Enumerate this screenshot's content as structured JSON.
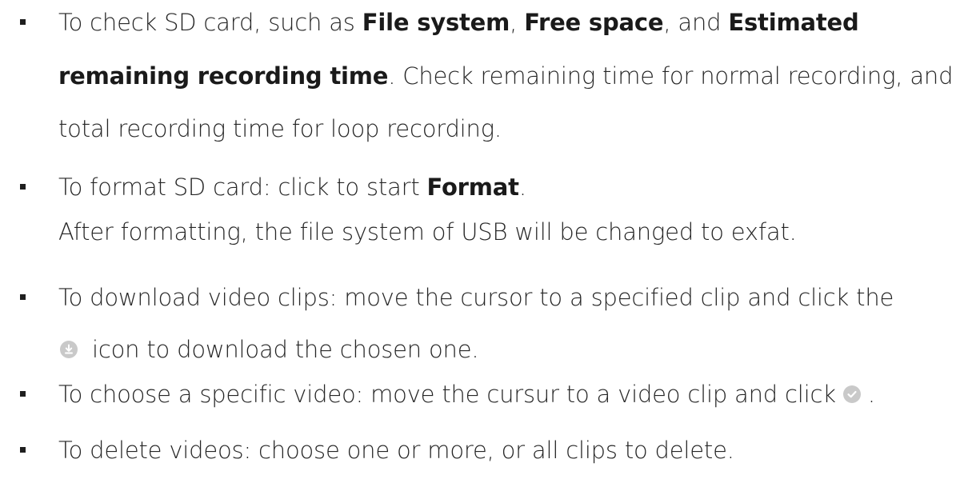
{
  "items": [
    {
      "lines": [
        [
          {
            "t": "To check SD card, such as "
          },
          {
            "t": "File system",
            "b": true
          },
          {
            "t": ", "
          },
          {
            "t": "Free space",
            "b": true
          },
          {
            "t": ", and "
          },
          {
            "t": "Estimated",
            "b": true
          }
        ],
        [
          {
            "t": "remaining recording time",
            "b": true
          },
          {
            "t": ". Check remaining time for normal recording, and"
          }
        ],
        [
          {
            "t": "total recording time for loop recording."
          }
        ]
      ]
    },
    {
      "lines": [
        [
          {
            "t": "To format SD card: click to start "
          },
          {
            "t": "Format",
            "b": true
          },
          {
            "t": "."
          }
        ],
        [
          {
            "t": "After formatting, the file system of USB will be changed to exfat."
          }
        ]
      ]
    },
    {
      "lines": [
        [
          {
            "t": "To download video clips: move the cursor to a specified clip and click the"
          }
        ],
        [
          {
            "icon": "download-icon"
          },
          {
            "t": "  icon to download the chosen one."
          }
        ]
      ]
    },
    {
      "lines": [
        [
          {
            "t": "To choose a specific video: move the cursur to a video clip and click "
          },
          {
            "icon": "check-circle-icon"
          },
          {
            "t": " ."
          }
        ]
      ]
    },
    {
      "lines": [
        [
          {
            "t": "To delete videos: choose one or more, or all clips to delete."
          }
        ]
      ]
    }
  ],
  "colors": {
    "text": "#262626",
    "bullet": "#1f1f1f",
    "icon_bg": "#c9c9c9",
    "icon_fg": "#ffffff"
  }
}
